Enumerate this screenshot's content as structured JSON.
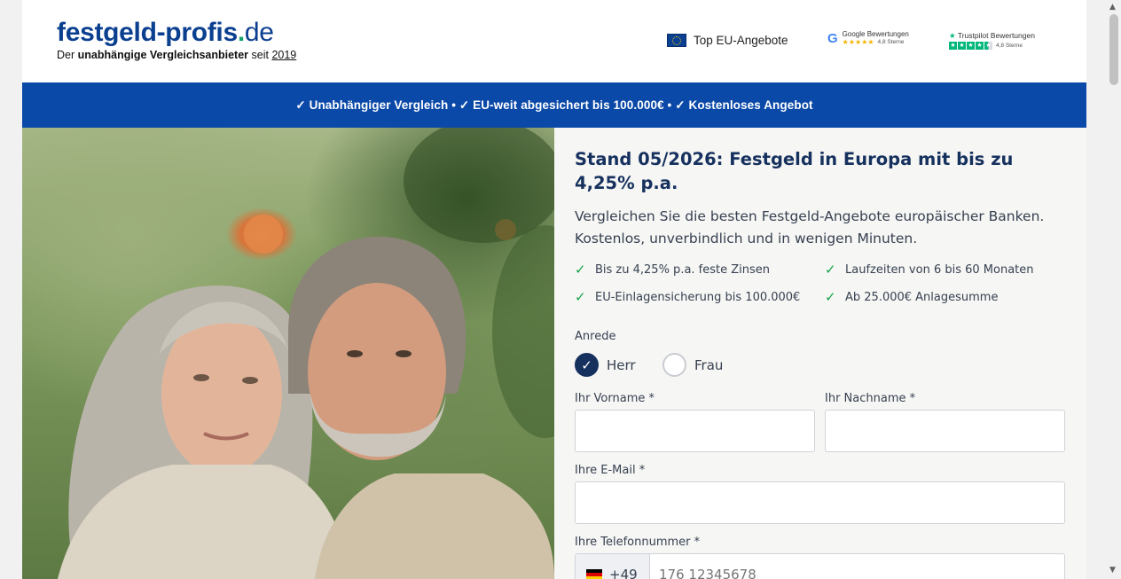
{
  "header": {
    "logo_part1": "festgeld-profis",
    "logo_dot": ".",
    "logo_tld": "de",
    "tagline_prefix": "Der ",
    "tagline_bold": "unabhängige Vergleichsanbieter",
    "tagline_mid": " seit ",
    "tagline_year": "2019",
    "eu_badge": "Top EU-Angebote",
    "google": {
      "title": "Google Bewertungen",
      "score": "4,8 Sterne",
      "icon": "google-icon",
      "stars": "★★★★★"
    },
    "trustpilot": {
      "title": "Trustpilot Bewertungen",
      "score": "4,8 Sterne",
      "icon": "trustpilot-star-icon"
    }
  },
  "banner": {
    "text": "✓ Unabhängiger Vergleich • ✓ EU-weit abgesichert bis 100.000€ • ✓ Kostenloses Angebot"
  },
  "hero": {
    "alt": "Älteres Paar im Garten"
  },
  "form": {
    "headline": "Stand 05/2026: Festgeld in Europa mit bis zu 4,25% p.a.",
    "subtext": "Vergleichen Sie die besten Festgeld-Angebote europäischer Banken. Kostenlos, unverbindlich und in wenigen Minuten.",
    "features": [
      "Bis zu 4,25% p.a. feste Zinsen",
      "Laufzeiten von 6 bis 60 Monaten",
      "EU-Einlagensicherung bis 100.000€",
      "Ab 25.000€ Anlagesumme"
    ],
    "anrede_label": "Anrede",
    "anrede_options": [
      "Herr",
      "Frau"
    ],
    "anrede_selected": "Herr",
    "vorname_label": "Ihr Vorname *",
    "nachname_label": "Ihr Nachname *",
    "email_label": "Ihre E-Mail *",
    "phone_label": "Ihre Telefonnummer *",
    "phone_country_code": "+49",
    "phone_placeholder": "176 12345678"
  },
  "colors": {
    "brand_blue": "#0b49a8",
    "headline_navy": "#16315e",
    "check_green": "#16a34a"
  }
}
